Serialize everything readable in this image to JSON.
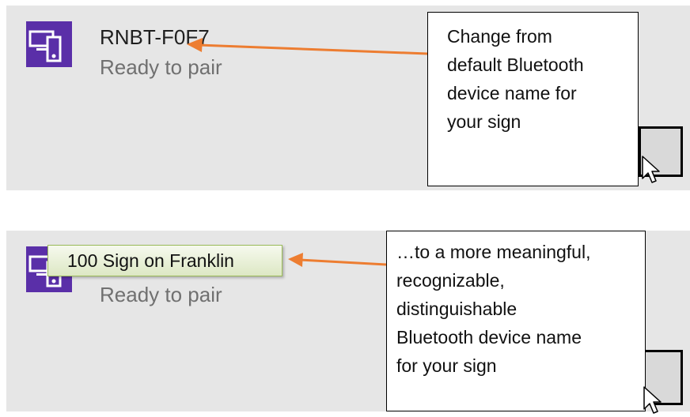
{
  "accent_color": "#5a2fa8",
  "arrow_color": "#ed7d31",
  "panels": [
    {
      "device_name": "RNBT-F0F7",
      "status": "Ready to pair",
      "icon": "devices-icon"
    },
    {
      "device_name": "100 Sign on Franklin",
      "status": "Ready to pair",
      "icon": "devices-icon"
    }
  ],
  "callouts": {
    "top": [
      "Change from",
      "default Bluetooth",
      "device name for",
      "your sign"
    ],
    "bottom": [
      "…to a more meaningful,",
      "recognizable,",
      "distinguishable",
      "Bluetooth device name",
      "for your sign"
    ]
  },
  "cursor_icon": "mouse-pointer-icon"
}
